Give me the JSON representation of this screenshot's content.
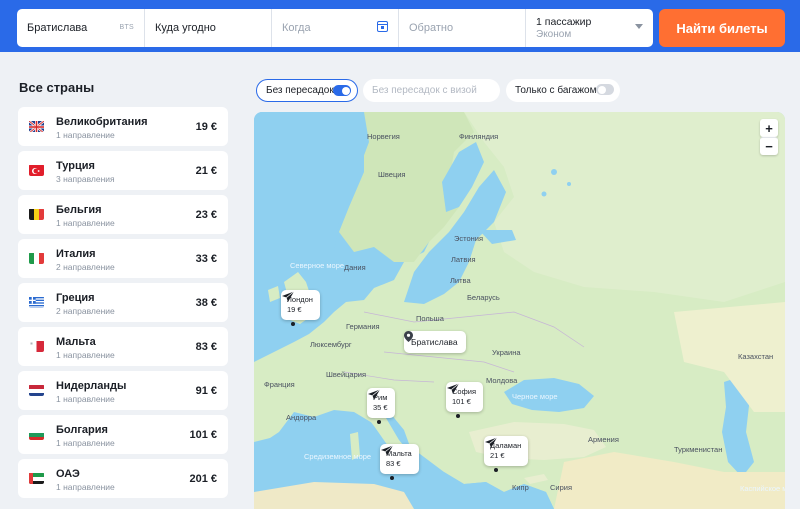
{
  "search": {
    "from": "Братислава",
    "from_code": "BTS",
    "to": "Куда угодно",
    "when_placeholder": "Когда",
    "return_placeholder": "Обратно",
    "passengers": "1 пассажир",
    "cabin": "Эконом",
    "submit_label": "Найти билеты"
  },
  "sidebar": {
    "title": "Все страны",
    "countries": [
      {
        "name": "Великобритания",
        "sub": "1 направление",
        "price": "19 €",
        "flag": "gb"
      },
      {
        "name": "Турция",
        "sub": "3 направления",
        "price": "21 €",
        "flag": "tr"
      },
      {
        "name": "Бельгия",
        "sub": "1 направление",
        "price": "23 €",
        "flag": "be"
      },
      {
        "name": "Италия",
        "sub": "2 направление",
        "price": "33 €",
        "flag": "it"
      },
      {
        "name": "Греция",
        "sub": "2 направление",
        "price": "38 €",
        "flag": "gr"
      },
      {
        "name": "Мальта",
        "sub": "1 направление",
        "price": "83 €",
        "flag": "mt"
      },
      {
        "name": "Нидерланды",
        "sub": "1 направление",
        "price": "91 €",
        "flag": "nl"
      },
      {
        "name": "Болгария",
        "sub": "1 направление",
        "price": "101 €",
        "flag": "bg"
      },
      {
        "name": "ОАЭ",
        "sub": "1 направление",
        "price": "201 €",
        "flag": "ae"
      }
    ]
  },
  "filters": {
    "direct": {
      "label": "Без пересадок",
      "on": true
    },
    "no_visa": {
      "label": "Без пересадок с визой",
      "on": false
    },
    "baggage": {
      "label": "Только с багажом",
      "on": false
    }
  },
  "map": {
    "zoom_in": "+",
    "zoom_out": "−",
    "home": "Братислава",
    "destinations": [
      {
        "city": "Лондон",
        "price": "19 €"
      },
      {
        "city": "Рим",
        "price": "35 €"
      },
      {
        "city": "София",
        "price": "101 €"
      },
      {
        "city": "Мальта",
        "price": "83 €"
      },
      {
        "city": "Даламан",
        "price": "21 €"
      }
    ],
    "labels": {
      "norway": "Норвегия",
      "finland": "Финляндия",
      "sweden": "Швеция",
      "estonia": "Эстония",
      "latvia": "Латвия",
      "lithuania": "Литва",
      "denmark": "Дания",
      "belarus": "Беларусь",
      "north_sea": "Северное море",
      "germany": "Германия",
      "poland": "Польша",
      "luxembourg": "Люксембург",
      "ukraine": "Украина",
      "moldova": "Молдова",
      "switzerland": "Швейцария",
      "france": "Франция",
      "kazakhstan": "Казахстан",
      "black_sea": "Черное море",
      "andorra": "Андорра",
      "armenia": "Армения",
      "mediterranean": "Средиземное море",
      "turkmenistan": "Туркменистан",
      "cyprus": "Кипр",
      "syria": "Сирия",
      "caspian_sea": "Каспийское море"
    }
  }
}
